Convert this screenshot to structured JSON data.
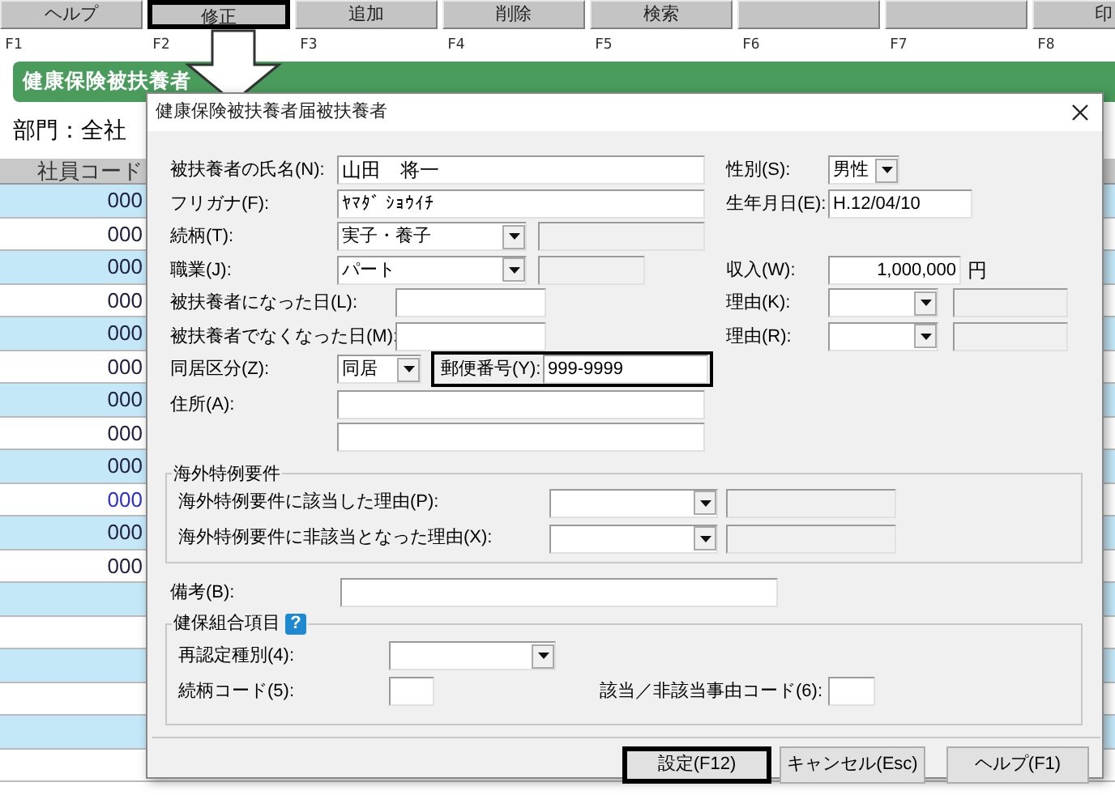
{
  "toolbar": [
    {
      "label": "ヘルプ",
      "key": "F1",
      "highlighted": false
    },
    {
      "label": "修正",
      "key": "F2",
      "highlighted": true
    },
    {
      "label": "追加",
      "key": "F3",
      "highlighted": false
    },
    {
      "label": "削除",
      "key": "F4",
      "highlighted": false
    },
    {
      "label": "検索",
      "key": "F5",
      "highlighted": false
    },
    {
      "key": "F6",
      "highlighted": false
    },
    {
      "key": "F7",
      "highlighted": false
    },
    {
      "label": "印",
      "key": "F8",
      "highlighted": false
    }
  ],
  "header_title": "健康保険被扶養者",
  "department": "部門：全社",
  "table": {
    "columns": [
      "社員コード"
    ],
    "rows": [
      {
        "code": "000",
        "current": false
      },
      {
        "code": "000",
        "current": false
      },
      {
        "code": "000",
        "current": false
      },
      {
        "code": "000",
        "current": false
      },
      {
        "code": "000",
        "current": false
      },
      {
        "code": "000",
        "current": false
      },
      {
        "code": "000",
        "current": false
      },
      {
        "code": "000",
        "current": false
      },
      {
        "code": "000",
        "current": false
      },
      {
        "code": "000",
        "current": true
      },
      {
        "code": "000",
        "current": false
      },
      {
        "code": "000",
        "current": false
      }
    ]
  },
  "dialog": {
    "title": "健康保険被扶養者届被扶養者",
    "name": {
      "label": "被扶養者の氏名(N):",
      "value": "山田　将一"
    },
    "kana": {
      "label": "フリガナ(F):",
      "value": "ﾔﾏﾀﾞ ｼｮｳｲﾁ"
    },
    "gender": {
      "label": "性別(S):",
      "value": "男性"
    },
    "birth": {
      "label": "生年月日(E):",
      "value": "H.12/04/10"
    },
    "relation": {
      "label": "続柄(T):",
      "value": "実子・養子"
    },
    "job": {
      "label": "職業(J):",
      "value": "パート"
    },
    "income": {
      "label": "収入(W):",
      "value": "1,000,000",
      "unit": "円"
    },
    "start_date": {
      "label": "被扶養者になった日(L):"
    },
    "reason_k": {
      "label": "理由(K):"
    },
    "end_date": {
      "label": "被扶養者でなくなった日(M):"
    },
    "reason_r": {
      "label": "理由(R):"
    },
    "cohabit": {
      "label": "同居区分(Z):",
      "value": "同居"
    },
    "zip": {
      "label": "郵便番号(Y):",
      "value": "999-9999",
      "highlighted": true
    },
    "address": {
      "label": "住所(A):"
    },
    "overseas": {
      "legend": "海外特例要件",
      "rows": [
        {
          "label": "海外特例要件に該当した理由(P):"
        },
        {
          "label": "海外特例要件に非該当となった理由(X):"
        }
      ]
    },
    "remarks": {
      "label": "備考(B):"
    },
    "union": {
      "legend": "健保組合項目",
      "help": "?",
      "recert": {
        "label": "再認定種別(4):"
      },
      "relation_code": {
        "label": "続柄コード(5):"
      },
      "reason_code": {
        "label": "該当／非該当事由コード(6):"
      }
    },
    "buttons": [
      {
        "label": "設定(F12)",
        "highlighted": true
      },
      {
        "label": "キャンセル(Esc)",
        "highlighted": false
      },
      {
        "label": "ヘルプ(F1)",
        "highlighted": false
      }
    ]
  }
}
